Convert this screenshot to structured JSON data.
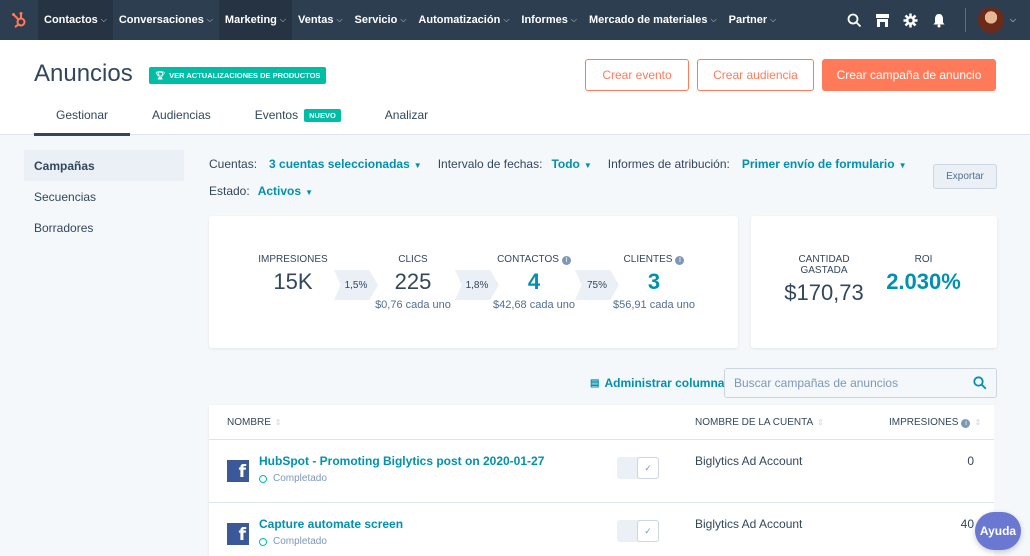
{
  "nav": {
    "items": [
      {
        "label": "Contactos",
        "active": true
      },
      {
        "label": "Conversaciones",
        "active": false
      },
      {
        "label": "Marketing",
        "active": true
      },
      {
        "label": "Ventas",
        "active": false
      },
      {
        "label": "Servicio",
        "active": false
      },
      {
        "label": "Automatización",
        "active": false
      },
      {
        "label": "Informes",
        "active": false
      },
      {
        "label": "Mercado de materiales",
        "active": false
      },
      {
        "label": "Partner",
        "active": false
      }
    ],
    "icons": [
      "search-icon",
      "marketplace-icon",
      "gear-icon",
      "bell-icon"
    ]
  },
  "header": {
    "title": "Anuncios",
    "updates_badge": "VER ACTUALIZACIONES DE PRODUCTOS",
    "btn_event": "Crear evento",
    "btn_audience": "Crear audiencia",
    "btn_campaign": "Crear campaña de anuncio",
    "tabs": [
      {
        "label": "Gestionar",
        "active": true
      },
      {
        "label": "Audiencias",
        "active": false
      },
      {
        "label": "Eventos",
        "active": false,
        "badge": "NUEVO"
      },
      {
        "label": "Analizar",
        "active": false
      }
    ]
  },
  "leftnav": {
    "items": [
      {
        "label": "Campañas",
        "active": true
      },
      {
        "label": "Secuencias",
        "active": false
      },
      {
        "label": "Borradores",
        "active": false
      }
    ]
  },
  "filters": {
    "accounts_label": "Cuentas:",
    "accounts_value": "3 cuentas seleccionadas",
    "date_label": "Intervalo de fechas:",
    "date_value": "Todo",
    "attribution_label": "Informes de atribución:",
    "attribution_value": "Primer envío de formulario",
    "status_label": "Estado:",
    "status_value": "Activos",
    "export": "Exportar"
  },
  "funnel": {
    "impressions": {
      "label": "IMPRESIONES",
      "value": "15K"
    },
    "rate1": "1,5%",
    "clicks": {
      "label": "CLICS",
      "value": "225",
      "sub": "$0,76 cada uno"
    },
    "rate2": "1,8%",
    "contacts": {
      "label": "CONTACTOS",
      "value": "4",
      "sub": "$42,68 cada uno"
    },
    "rate3": "75%",
    "customers": {
      "label": "CLIENTES",
      "value": "3",
      "sub": "$56,91 cada uno"
    }
  },
  "summary": {
    "spent_label": "CANTIDAD GASTADA",
    "spent_value": "$170,73",
    "roi_label": "ROI",
    "roi_value": "2.030%"
  },
  "table_controls": {
    "manage_columns": "Administrar columnas",
    "search_placeholder": "Buscar campañas de anuncios"
  },
  "table": {
    "headers": [
      "NOMBRE",
      "NOMBRE DE LA CUENTA",
      "IMPRESIONES"
    ],
    "rows": [
      {
        "name": "HubSpot - Promoting Biglytics post on 2020-01-27",
        "status": "Completado",
        "account": "Biglytics Ad Account",
        "impressions": "0"
      },
      {
        "name": "Capture automate screen",
        "status": "Completado",
        "account": "Biglytics Ad Account",
        "impressions": "40"
      }
    ]
  },
  "help": "Ayuda",
  "colors": {
    "accent": "#ff7a59",
    "teal": "#00bda5",
    "link": "#0091ae",
    "nav": "#2d3e50"
  }
}
